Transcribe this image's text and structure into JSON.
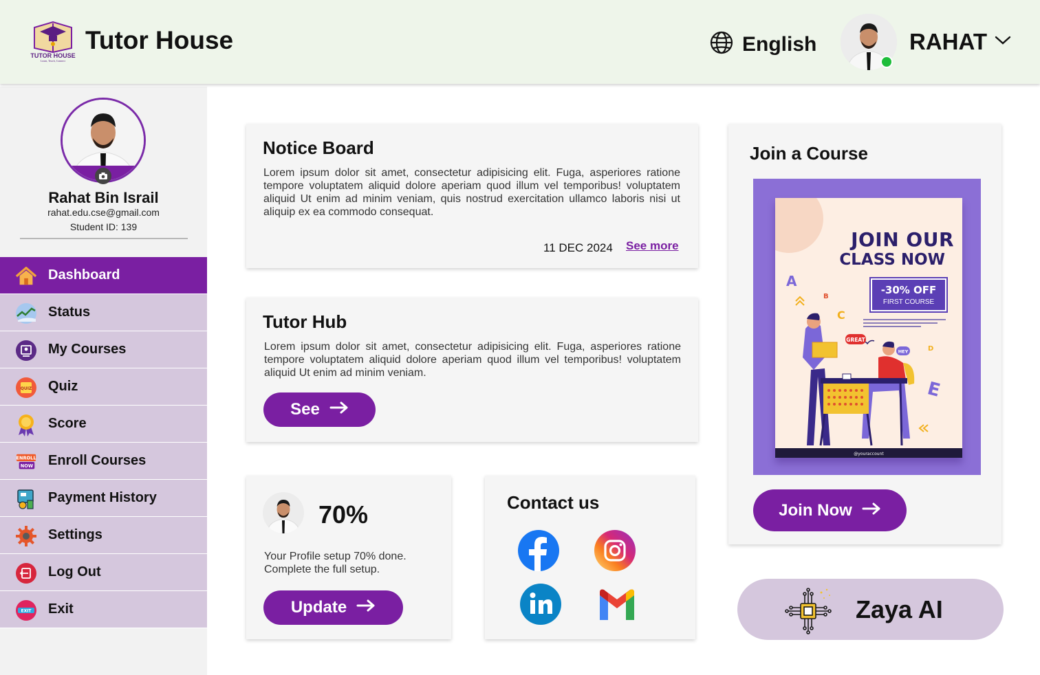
{
  "header": {
    "logo_text": "TUTOR HOUSE",
    "logo_tagline": "Learn, Teach, Connect",
    "brand_title": "Tutor House",
    "language": "English",
    "user_name": "RAHAT"
  },
  "profile": {
    "name": "Rahat Bin Israil",
    "email": "rahat.edu.cse@gmail.com",
    "student_id": "Student ID: 139"
  },
  "sidebar": {
    "items": [
      {
        "label": "Dashboard",
        "icon": "home-icon",
        "active": true
      },
      {
        "label": "Status",
        "icon": "chart-status-icon"
      },
      {
        "label": "My Courses",
        "icon": "courses-icon"
      },
      {
        "label": "Quiz",
        "icon": "quiz-icon"
      },
      {
        "label": "Score",
        "icon": "medal-icon"
      },
      {
        "label": "Enroll Courses",
        "icon": "enroll-now-icon"
      },
      {
        "label": "Payment History",
        "icon": "payment-icon"
      },
      {
        "label": "Settings",
        "icon": "gear-icon"
      },
      {
        "label": "Log Out",
        "icon": "logout-icon"
      },
      {
        "label": "Exit",
        "icon": "exit-icon"
      }
    ]
  },
  "notice": {
    "title": "Notice Board",
    "body": "Lorem ipsum dolor sit amet, consectetur adipisicing elit. Fuga, asperiores ratione tempore voluptatem aliquid dolore aperiam quod illum vel temporibus! voluptatem aliquid Ut enim ad minim veniam, quis nostrud exercitation ullamco laboris nisi ut aliquip ex ea commodo consequat.",
    "date": "11 DEC 2024",
    "see_more": "See more"
  },
  "tutor_hub": {
    "title": "Tutor Hub",
    "body": "Lorem ipsum dolor sit amet, consectetur adipisicing elit. Fuga, asperiores ratione tempore voluptatem aliquid dolore aperiam quod illum vel temporibus! voluptatem aliquid Ut enim ad minim veniam.",
    "button": "See"
  },
  "progress": {
    "percent_text": "70%",
    "percent_value": 0.7,
    "message": "Your Profile setup 70% done. Complete the full setup.",
    "button": "Update"
  },
  "contact": {
    "title": "Contact us",
    "icons": [
      "facebook-icon",
      "instagram-icon",
      "linkedin-icon",
      "gmail-icon"
    ]
  },
  "course": {
    "title": "Join a Course",
    "poster_line1": "JOIN OUR",
    "poster_line2": "CLASS NOW",
    "discount": "-30% OFF",
    "discount_sub": "FIRST COURSE",
    "bubble_great": "GREAT",
    "bubble_hey": "HEY",
    "poster_footer": "@youraccount",
    "button": "Join Now"
  },
  "zaya": {
    "label": "Zaya AI"
  },
  "colors": {
    "primary": "#7a1fa2",
    "header_bg": "#eef5ea",
    "nav_bg": "#d5c7dd",
    "card_bg": "#f5f5f5",
    "poster_frame": "#8b6fd6",
    "online": "#1ebd3a"
  }
}
